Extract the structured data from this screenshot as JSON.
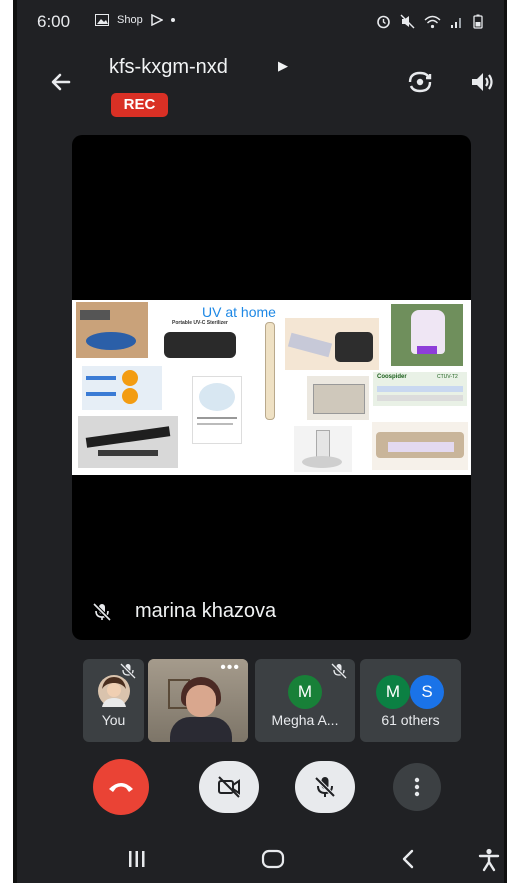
{
  "status_bar": {
    "time": "6:00",
    "left_icons": [
      "image-icon",
      "Shop",
      "play-store-icon",
      "dot-icon"
    ],
    "right_icons": [
      "alarm-icon",
      "mute-icon",
      "wifi-icon",
      "signal-icon",
      "battery-icon"
    ]
  },
  "header": {
    "meeting_code": "kfs-kxgm-nxd",
    "recording_badge": "REC"
  },
  "presentation": {
    "slide_title": "UV at home",
    "thumb_labels": {
      "sterilizer": "Portable UV-C Sterilizer",
      "coospider": "Coospider",
      "coospider_model": "CTUV-T2"
    },
    "presenter_name": "marina khazova",
    "presenter_muted": true
  },
  "participants": [
    {
      "name": "You",
      "muted": true
    },
    {
      "name": "",
      "muted": false
    },
    {
      "name": "Megha A...",
      "initial": "M",
      "muted": true,
      "color": "#188038"
    },
    {
      "name": "61 others",
      "initials": [
        "M",
        "S"
      ],
      "colors": [
        "#0b8043",
        "#1a73e8"
      ]
    }
  ],
  "controls": {
    "end_call": "end-call",
    "camera": "camera-off",
    "mic": "mic-off",
    "more": "more-options"
  },
  "colors": {
    "background": "#202124",
    "tile": "#3c4043",
    "rec": "#d93025",
    "end_call": "#ea4335",
    "control_light": "#e8eaed",
    "control_dark": "#3c4043"
  }
}
